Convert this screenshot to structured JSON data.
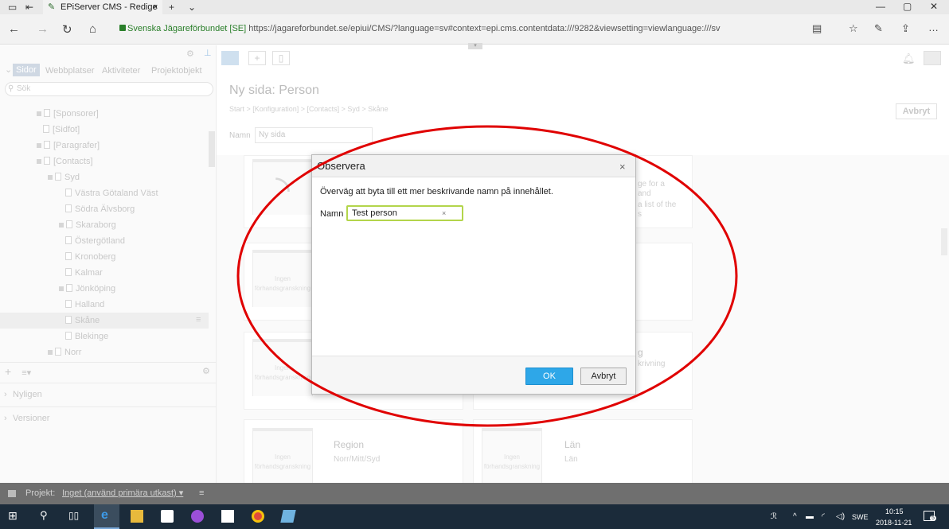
{
  "browser": {
    "tab_title": "EPiServer CMS - Redige",
    "new_tab": "+",
    "tab_menu": "⌄",
    "url_site": "Svenska Jägareförbundet [SE]",
    "url": "https://jagareforbundet.se/epiui/CMS/?language=sv#context=epi.cms.contentdata:///9282&viewsetting=viewlanguage:///sv",
    "more": "…"
  },
  "left_pane": {
    "tabs": [
      "Sidor",
      "Webbplatser",
      "Aktiviteter",
      "Projektobjekt"
    ],
    "search_placeholder": "Sök",
    "tree": [
      {
        "label": "[Sponsorer]",
        "expand": true
      },
      {
        "label": "[Sidfot]",
        "expand": false
      },
      {
        "label": "[Paragrafer]",
        "expand": true
      },
      {
        "label": "[Contacts]",
        "expand": true
      },
      {
        "label": "Syd",
        "expand": true
      },
      {
        "label": "Västra Götaland Väst",
        "expand": false
      },
      {
        "label": "Södra Älvsborg",
        "expand": false
      },
      {
        "label": "Skaraborg",
        "expand": true
      },
      {
        "label": "Östergötland",
        "expand": false
      },
      {
        "label": "Kronoberg",
        "expand": false
      },
      {
        "label": "Kalmar",
        "expand": false
      },
      {
        "label": "Jönköping",
        "expand": true
      },
      {
        "label": "Halland",
        "expand": false
      },
      {
        "label": "Skåne",
        "expand": false
      },
      {
        "label": "Blekinge",
        "expand": false
      },
      {
        "label": "Norr",
        "expand": true
      }
    ],
    "sections": [
      "Nyligen",
      "Versioner"
    ]
  },
  "main": {
    "page_title": "Ny sida: Person",
    "breadcrumb": "Start > [Konfiguration] > [Contacts] > Syd > Skåne",
    "name_label": "Namn",
    "name_placeholder": "Ny sida",
    "cancel_label": "Avbryt",
    "card_snippets": {
      "a": "ge for a",
      "b": "and",
      "c": "a list of the",
      "d": "s",
      "e": "g",
      "f": "krivning"
    },
    "no_preview_1": "Ingen",
    "no_preview_2": "förhandsgranskning",
    "cards_bottom": [
      {
        "title": "Region",
        "sub": "Norr/Mitt/Syd"
      },
      {
        "title": "Län",
        "sub": "Län"
      }
    ]
  },
  "dialog": {
    "title": "Observera",
    "close": "×",
    "message": "Överväg att byta till ett mer beskrivande namn på innehållet.",
    "name_label": "Namn",
    "name_value": "Test person",
    "clear": "×",
    "ok_label": "OK",
    "cancel_label": "Avbryt"
  },
  "project_bar": {
    "label": "Projekt:",
    "value": "Inget (använd primära utkast) ▾",
    "menu": "≡"
  },
  "taskbar": {
    "lang": "SWE",
    "time": "10:15",
    "date": "2018-11-21",
    "notif_count": "5"
  },
  "colors": {
    "annotation": "#e00000",
    "ok_button": "#2ea7e8",
    "input_focus": "#b3d54b",
    "taskbar": "#1b2b3a"
  }
}
